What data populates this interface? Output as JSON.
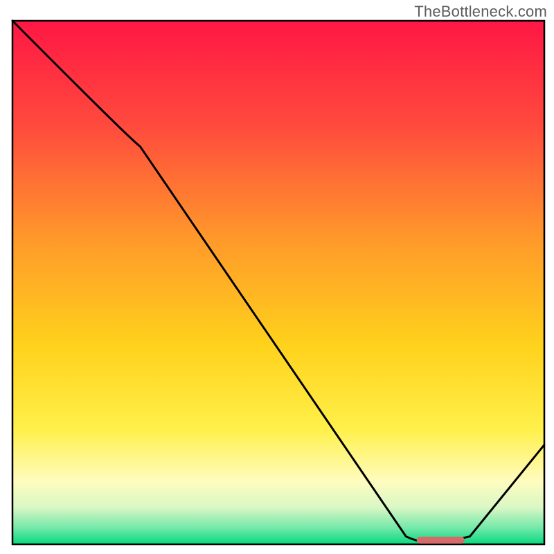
{
  "watermark": "TheBottleneck.com",
  "chart_data": {
    "type": "line",
    "title": "",
    "xlabel": "",
    "ylabel": "",
    "xlim": [
      0,
      100
    ],
    "ylim": [
      0,
      100
    ],
    "x": [
      0,
      24,
      74,
      78,
      86,
      100
    ],
    "values": [
      100,
      76,
      1.5,
      0.5,
      1.5,
      19
    ],
    "optimal_marker": {
      "x_start": 76,
      "x_end": 85,
      "y": 0.8
    },
    "gradient_stops": [
      {
        "offset": 0.0,
        "color": "#ff1744"
      },
      {
        "offset": 0.2,
        "color": "#ff4a3d"
      },
      {
        "offset": 0.42,
        "color": "#ff9a2a"
      },
      {
        "offset": 0.62,
        "color": "#ffd21c"
      },
      {
        "offset": 0.78,
        "color": "#fff04a"
      },
      {
        "offset": 0.88,
        "color": "#fffcbf"
      },
      {
        "offset": 0.93,
        "color": "#d8f7c4"
      },
      {
        "offset": 0.97,
        "color": "#6fe8a8"
      },
      {
        "offset": 1.0,
        "color": "#06d97e"
      }
    ],
    "frame_color": "#000000",
    "curve_color": "#000000",
    "marker_color": "#d46a6a"
  }
}
